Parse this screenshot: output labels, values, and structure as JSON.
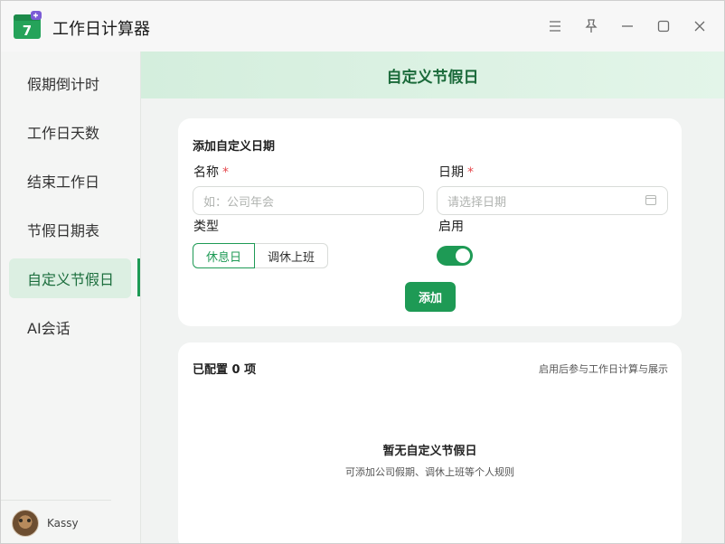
{
  "app": {
    "title": "工作日计算器",
    "icon_number": "7"
  },
  "window_controls": [
    "menu-icon",
    "pin-icon",
    "minimize-icon",
    "maximize-icon",
    "close-icon"
  ],
  "sidebar": {
    "items": [
      {
        "label": "假期倒计时",
        "active": false
      },
      {
        "label": "工作日天数",
        "active": false
      },
      {
        "label": "结束工作日",
        "active": false
      },
      {
        "label": "节假日期表",
        "active": false
      },
      {
        "label": "自定义节假日",
        "active": true
      },
      {
        "label": "AI会话",
        "active": false
      }
    ],
    "user": {
      "name": "Kassy"
    }
  },
  "page": {
    "title": "自定义节假日"
  },
  "form": {
    "title": "添加自定义日期",
    "name_label": "名称",
    "name_placeholder": "如：公司年会",
    "date_label": "日期",
    "date_placeholder": "请选择日期",
    "required_mark": "*",
    "type_label": "类型",
    "type_options": [
      "休息日",
      "调休上班"
    ],
    "type_selected": "休息日",
    "enable_label": "启用",
    "enabled": true,
    "add_button": "添加"
  },
  "list": {
    "count_label": "已配置 0 项",
    "hint": "启用后参与工作日计算与展示",
    "empty_title": "暂无自定义节假日",
    "empty_sub": "可添加公司假期、调休上班等个人规则"
  },
  "colors": {
    "accent": "#1e9a55",
    "accent_light": "#dcefe2",
    "required": "#e5484d"
  }
}
